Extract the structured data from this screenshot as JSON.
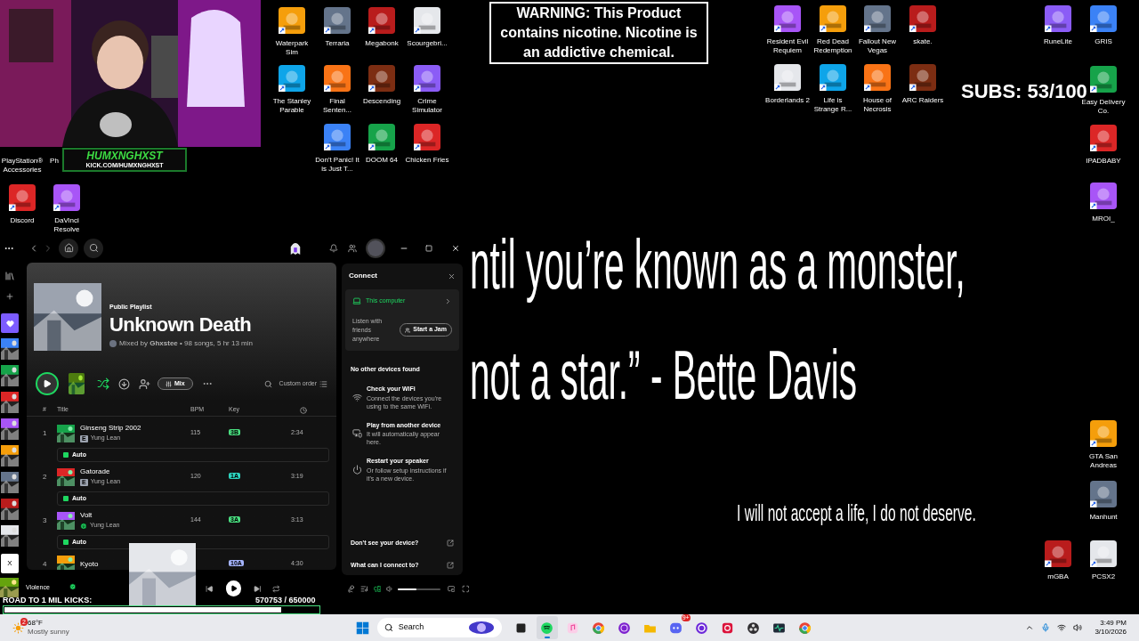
{
  "webcam": {
    "kind": "picture"
  },
  "stream_badge": {
    "name": "HUMXNGHXST",
    "url": "KICK.COM/HUMXNGHXST"
  },
  "warning": "WARNING: This Product contains nicotine. Nicotine is an addictive chemical.",
  "subs": "SUBS: 53/100",
  "quote_lines": [
    "ntil you’re known as a monster,",
    "not a star.” - Bette Davis"
  ],
  "motto": "I will not accept a life, I do not deserve.",
  "desktop_icons": [
    {
      "label": "PlayStation® Accessories"
    },
    {
      "label": "Ph"
    },
    {
      "label": "Discord"
    },
    {
      "label": "DaVinci Resolve"
    },
    {
      "label": "Waterpark Sim"
    },
    {
      "label": "Terraria"
    },
    {
      "label": "Megabonk"
    },
    {
      "label": "Scourgebri..."
    },
    {
      "label": "The Stanley Parable"
    },
    {
      "label": "Final Senten..."
    },
    {
      "label": "Descending"
    },
    {
      "label": "Crime Simulator"
    },
    {
      "label": "Don't Panic! It is Just T..."
    },
    {
      "label": "DOOM 64"
    },
    {
      "label": "Chicken Fries"
    },
    {
      "label": "Resident Evil Requiem"
    },
    {
      "label": "Red Dead Redemption"
    },
    {
      "label": "Fallout New Vegas"
    },
    {
      "label": "skate."
    },
    {
      "label": "Borderlands 2"
    },
    {
      "label": "Life is Strange R..."
    },
    {
      "label": "House of Necrosis"
    },
    {
      "label": "ARC Raiders"
    },
    {
      "label": "RuneLite"
    },
    {
      "label": "GRIS"
    },
    {
      "label": "Easy Delivery Co."
    },
    {
      "label": "IPADBABY"
    },
    {
      "label": "MROI_"
    },
    {
      "label": "GTA San Andreas"
    },
    {
      "label": "Manhunt"
    },
    {
      "label": "mGBA"
    },
    {
      "label": "PCSX2"
    }
  ],
  "spotify": {
    "library_close": "X",
    "playlist": {
      "type": "Public Playlist",
      "title": "Unknown Death",
      "byline": "Mixed by **Ghxstee** • 98 songs, 5 hr 13 min"
    },
    "shuffle_on": true,
    "mix_label": "Mix",
    "sort_label": "Custom order",
    "columns": [
      "#",
      "Title",
      "BPM",
      "Key"
    ],
    "tracks": [
      {
        "number": "1",
        "title": "Ginseng Strip 2002",
        "artist": "Yung Lean",
        "flag": {
          "kind": "explicit",
          "text": "E"
        },
        "bpm": "115",
        "key": "3B",
        "color": "#4ade80",
        "duration": "2:34",
        "auto": "Auto"
      },
      {
        "number": "2",
        "title": "Gatorade",
        "artist": "Yung Lean",
        "flag": {
          "kind": "explicit",
          "text": "E"
        },
        "bpm": "120",
        "key": "1A",
        "color": "#2dd4bf",
        "duration": "3:19",
        "auto": "Auto"
      },
      {
        "number": "3",
        "title": "Volt",
        "artist": "Yung Lean",
        "flag": {
          "kind": "downloaded"
        },
        "bpm": "144",
        "key": "3A",
        "color": "#4ade80",
        "duration": "3:13",
        "auto": "Auto"
      },
      {
        "number": "4",
        "title": "Kyoto",
        "key": "10A",
        "color": "#a5b4fc",
        "duration": "4:30"
      }
    ]
  },
  "connect": {
    "title": "Connect",
    "device": {
      "name": "This computer",
      "selected": true
    },
    "jam_text": "Listen with friends anywhere",
    "jam_button": "Start a Jam",
    "heading": "No other devices found",
    "tips": [
      {
        "kind": "wifi",
        "title": "Check your WiFi",
        "text": "Connect the devices you're using to the same WiFi."
      },
      {
        "kind": "device",
        "title": "Play from another device",
        "text": "It will automatically appear here."
      },
      {
        "kind": "power",
        "title": "Restart your speaker",
        "text": "Or follow setup instructions if it's a new device."
      }
    ],
    "links": [
      "Don't see your device?",
      "What can I connect to?"
    ]
  },
  "player": {
    "track": "Violence",
    "saved": true,
    "connect_on": true,
    "volume": {
      "level": 0.45
    }
  },
  "kicks": {
    "label": "ROAD TO 1 MIL KICKS:",
    "count": "570753 / 650000",
    "level": 0.88
  },
  "taskbar": {
    "weather": {
      "temp": "68°F",
      "text": "Mostly sunny",
      "badge": "2"
    },
    "search": "Search",
    "apps": [
      {
        "kind": "task-view",
        "active": false
      },
      {
        "kind": "spotify",
        "active": true
      },
      {
        "kind": "music",
        "active": false
      },
      {
        "kind": "chrome",
        "active": false
      },
      {
        "kind": "orb",
        "active": false
      },
      {
        "kind": "folder",
        "active": false
      },
      {
        "kind": "discord",
        "active": false,
        "badge": "9+"
      },
      {
        "kind": "ring",
        "active": false
      },
      {
        "kind": "red",
        "active": false
      },
      {
        "kind": "obs",
        "active": false
      },
      {
        "kind": "wave",
        "active": false
      },
      {
        "kind": "chrome",
        "active": false
      }
    ],
    "time": "3:49 PM",
    "date": "3/10/2026"
  }
}
